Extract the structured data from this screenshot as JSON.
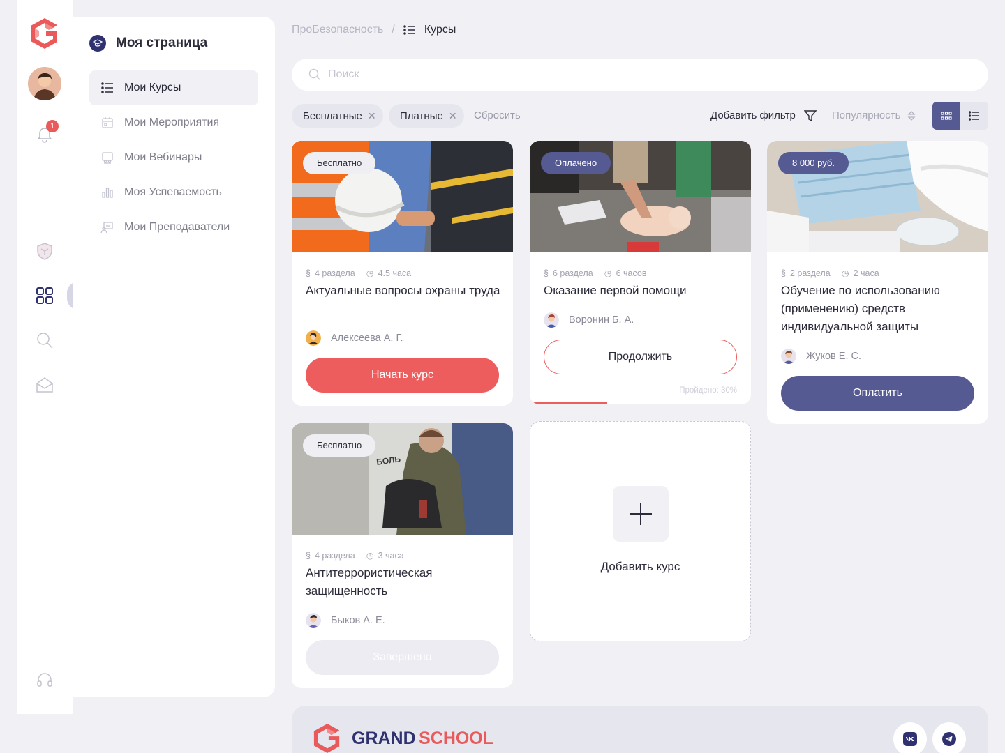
{
  "breadcrumb": {
    "root": "ПроБезопасность",
    "separator": "/",
    "current": "Курсы"
  },
  "rail": {
    "notification_count": "1"
  },
  "sidebar": {
    "title": "Моя страница",
    "items": [
      {
        "label": "Мои Курсы",
        "icon": "list-icon",
        "active": true
      },
      {
        "label": "Мои Мероприятия",
        "icon": "calendar-icon",
        "active": false
      },
      {
        "label": "Мои Вебинары",
        "icon": "webinar-icon",
        "active": false
      },
      {
        "label": "Моя Успеваемость",
        "icon": "bar-chart-icon",
        "active": false
      },
      {
        "label": "Мои Преподаватели",
        "icon": "teacher-icon",
        "active": false
      }
    ]
  },
  "search": {
    "placeholder": "Поиск",
    "value": ""
  },
  "filters": {
    "chips": [
      "Бесплатные",
      "Платные"
    ],
    "reset": "Сбросить",
    "add_filter": "Добавить фильтр",
    "sort": "Популярность",
    "view_mode": "grid"
  },
  "courses": [
    {
      "badge": "Бесплатно",
      "sections": "4 раздела",
      "duration": "4.5 часа",
      "title": "Актуальные вопросы охраны труда",
      "author": "Алексеева А. Г.",
      "button": "Начать курс"
    },
    {
      "badge": "Оплачено",
      "sections": "6 раздела",
      "duration": "6 часов",
      "title": "Оказание первой помощи",
      "author": "Воронин Б. А.",
      "button": "Продолжить",
      "progress_label": "Пройдено: 30%",
      "progress": 0.35
    },
    {
      "badge": "8 000 руб.",
      "sections": "2 раздела",
      "duration": "2 часа",
      "title": "Обучение по использованию (применению) средств индивидуальной защиты",
      "author": "Жуков Е. С.",
      "button": "Оплатить"
    },
    {
      "badge": "Бесплатно",
      "sections": "4 раздела",
      "duration": "3 часа",
      "title": "Антитеррористическая защищенность",
      "author": "Быков А. Е.",
      "button": "Завершено"
    }
  ],
  "add_course": {
    "label": "Добавить курс"
  },
  "footer": {
    "brand_primary": "GRAND",
    "brand_secondary": "SCHOOL"
  },
  "colors": {
    "accent_red": "#ee5d5d",
    "accent_navy": "#565a93",
    "brand_navy": "#2f3170"
  }
}
